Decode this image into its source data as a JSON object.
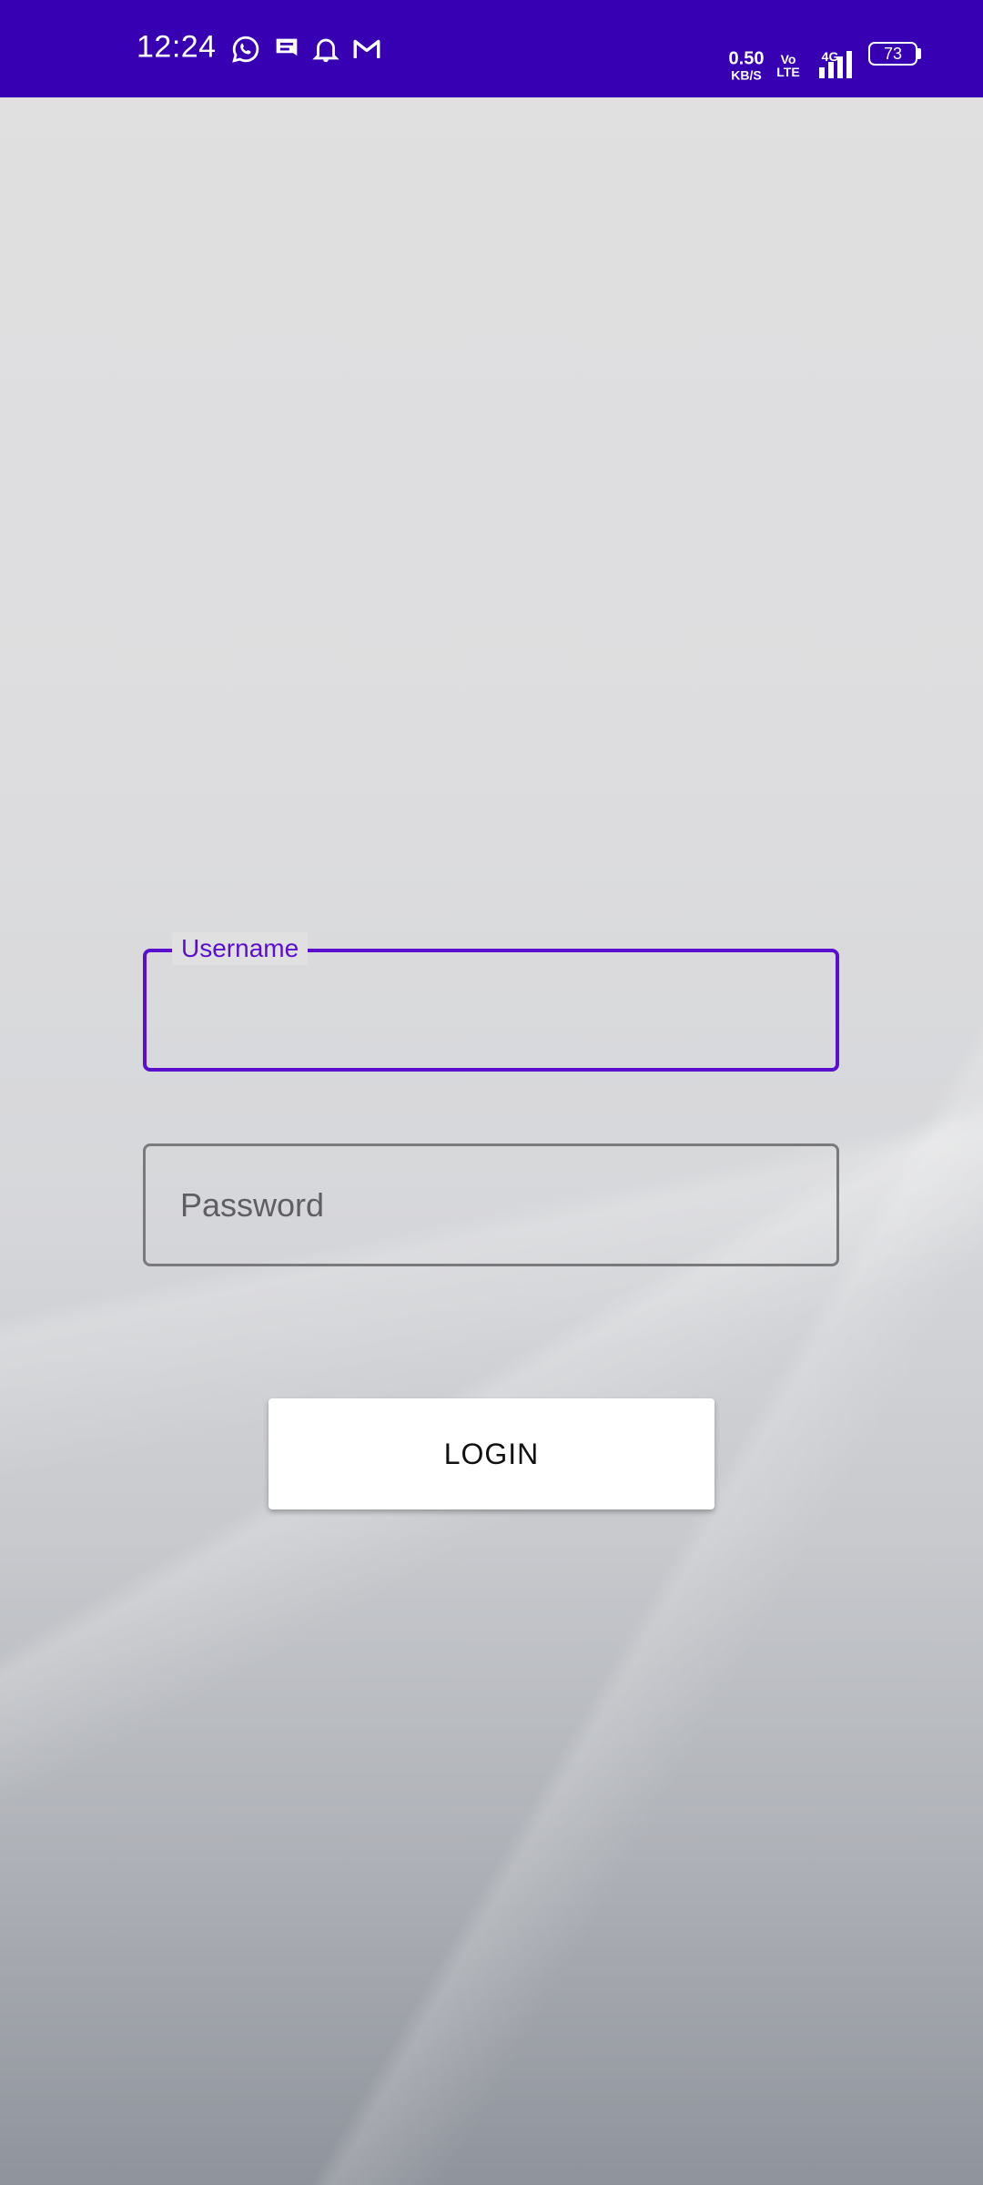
{
  "status_bar": {
    "time": "12:24",
    "notification_icons": [
      "whatsapp-icon",
      "message-icon",
      "bell-icon",
      "gmail-icon"
    ],
    "net_speed_value": "0.50",
    "net_speed_unit": "KB/S",
    "volte_top": "Vo",
    "volte_bottom": "LTE",
    "network_type": "4G",
    "battery_level": "73",
    "background_color": "#3700b3"
  },
  "login_form": {
    "username_label": "Username",
    "username_value": "",
    "password_placeholder": "Password",
    "password_value": "",
    "login_button_label": "LOGIN",
    "accent_color": "#5a0fcf"
  }
}
